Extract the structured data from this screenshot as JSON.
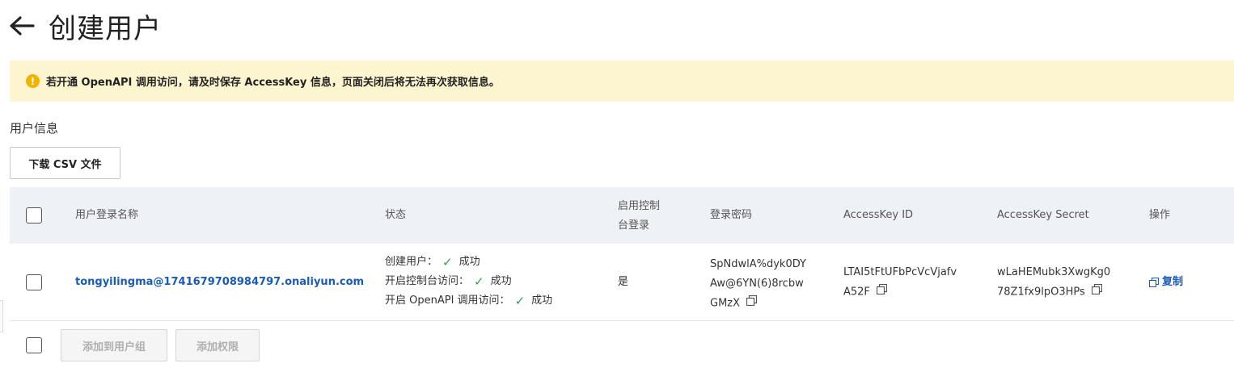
{
  "header": {
    "title": "创建用户"
  },
  "alert": {
    "text": "若开通 OpenAPI 调用访问，请及时保存 AccessKey 信息，页面关闭后将无法再次获取信息。"
  },
  "section": {
    "title": "用户信息"
  },
  "toolbar": {
    "download_label": "下载 CSV 文件"
  },
  "table": {
    "columns": {
      "login_name": "用户登录名称",
      "status": "状态",
      "console_login": "启用控制\n台登录",
      "password": "登录密码",
      "access_key_id": "AccessKey ID",
      "access_key_secret": "AccessKey Secret",
      "actions": "操作"
    },
    "rows": [
      {
        "login_name": "tongyilingma@1741679708984797.onaliyun.com",
        "status_lines": [
          {
            "label": "创建用户：",
            "result": "成功"
          },
          {
            "label": "开启控制台访问：",
            "result": "成功"
          },
          {
            "label": "开启 OpenAPI 调用访问：",
            "result": "成功"
          }
        ],
        "console_login": "是",
        "password": "SpNdwlA%dyk0DY\nAw@6YN(6)8rcbw\nGMzX",
        "access_key_id": "LTAI5tFtUFbPcVcVjafv\nA52F",
        "access_key_secret": "wLaHEMubk3XwgKg0\n78Z1fx9lpO3HPs",
        "action_copy": "复制"
      }
    ]
  },
  "footer": {
    "add_to_group_label": "添加到用户组",
    "add_permission_label": "添加权限"
  },
  "colors": {
    "link": "#1a5bb8",
    "success": "#2ea14b",
    "warning_bg": "#fdf5d0",
    "warning_icon": "#f0b400"
  }
}
